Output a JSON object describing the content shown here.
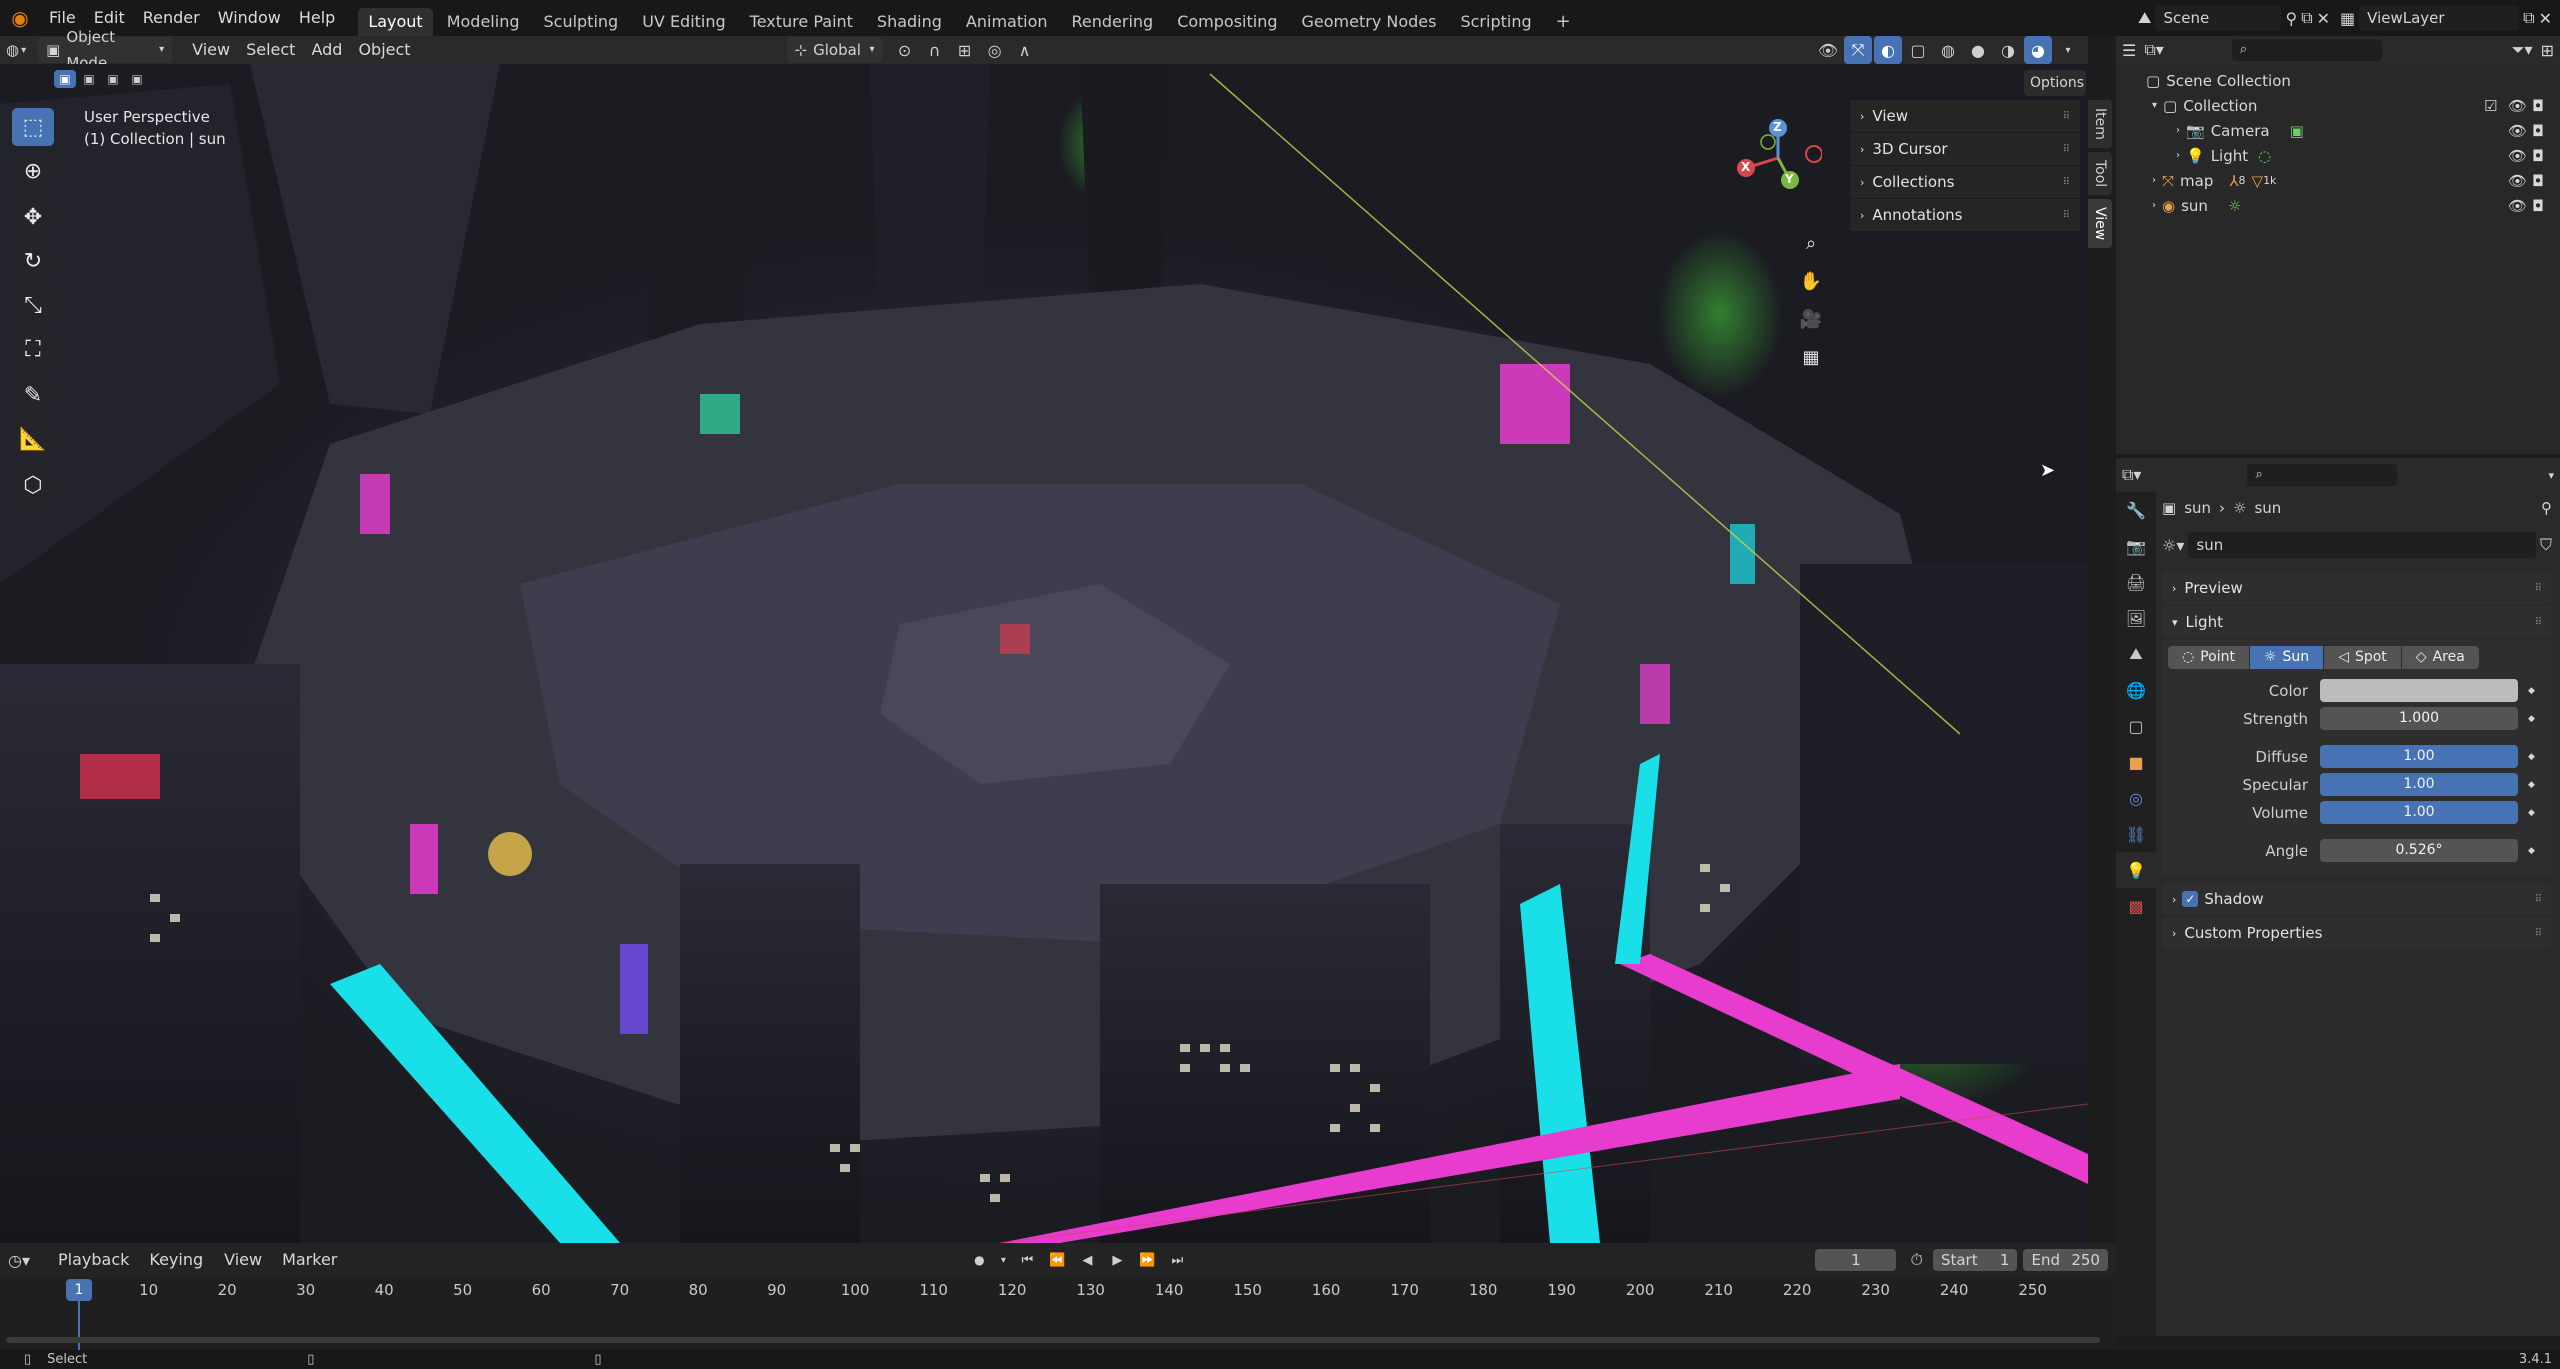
{
  "app": {
    "version": "3.4.1"
  },
  "menubar": {
    "items": [
      "File",
      "Edit",
      "Render",
      "Window",
      "Help"
    ],
    "workspaces": [
      "Layout",
      "Modeling",
      "Sculpting",
      "UV Editing",
      "Texture Paint",
      "Shading",
      "Animation",
      "Rendering",
      "Compositing",
      "Geometry Nodes",
      "Scripting"
    ],
    "active_workspace": "Layout",
    "scene": "Scene",
    "view_layer": "ViewLayer"
  },
  "viewport_header": {
    "mode": "Object Mode",
    "menus": [
      "View",
      "Select",
      "Add",
      "Object"
    ],
    "orientation": "Global",
    "options": "Options"
  },
  "viewport": {
    "perspective": "User Perspective",
    "context": "(1) Collection | sun",
    "gizmo": {
      "x": "X",
      "y": "Y",
      "z": "Z"
    },
    "npanel_sections": [
      "View",
      "3D Cursor",
      "Collections",
      "Annotations"
    ],
    "npanel_tabs": [
      "Item",
      "Tool",
      "View"
    ],
    "tools": [
      "select-box-icon",
      "cursor-icon",
      "move-icon",
      "rotate-icon",
      "scale-icon",
      "transform-icon",
      "annotate-icon",
      "measure-icon",
      "add-cube-icon"
    ]
  },
  "outliner": {
    "root": "Scene Collection",
    "collection": "Collection",
    "items": [
      {
        "name": "Camera",
        "indent": 2
      },
      {
        "name": "Light",
        "indent": 2
      },
      {
        "name": "map",
        "indent": 1,
        "badge1": "8",
        "badge2": "1k"
      },
      {
        "name": "sun",
        "indent": 1
      }
    ]
  },
  "properties": {
    "breadcrumb": {
      "object": "sun",
      "data": "sun"
    },
    "datablock": "sun",
    "panels": {
      "preview": "Preview",
      "light": "Light",
      "shadow": "Shadow",
      "custom": "Custom Properties"
    },
    "light_types": [
      "Point",
      "Sun",
      "Spot",
      "Area"
    ],
    "active_light_type": "Sun",
    "fields": {
      "color_label": "Color",
      "strength_label": "Strength",
      "strength": "1.000",
      "diffuse_label": "Diffuse",
      "diffuse": "1.00",
      "specular_label": "Specular",
      "specular": "1.00",
      "volume_label": "Volume",
      "volume": "1.00",
      "angle_label": "Angle",
      "angle": "0.526°"
    },
    "light_color": "#bcbcbc",
    "shadow_enabled": true
  },
  "timeline": {
    "menus": [
      "Playback",
      "Keying",
      "View",
      "Marker"
    ],
    "current_frame": "1",
    "start_label": "Start",
    "start": "1",
    "end_label": "End",
    "end": "250",
    "ticks": [
      "1",
      "10",
      "20",
      "30",
      "40",
      "50",
      "60",
      "70",
      "80",
      "90",
      "100",
      "110",
      "120",
      "130",
      "140",
      "150",
      "160",
      "170",
      "180",
      "190",
      "200",
      "210",
      "220",
      "230",
      "240",
      "250"
    ]
  },
  "statusbar": {
    "left": "Select",
    "version": "3.4.1"
  },
  "colors": {
    "accent": "#4772b3",
    "neon_cyan": "#19e0e8",
    "neon_magenta": "#e83ccf",
    "neon_green": "#4fdc4f"
  }
}
